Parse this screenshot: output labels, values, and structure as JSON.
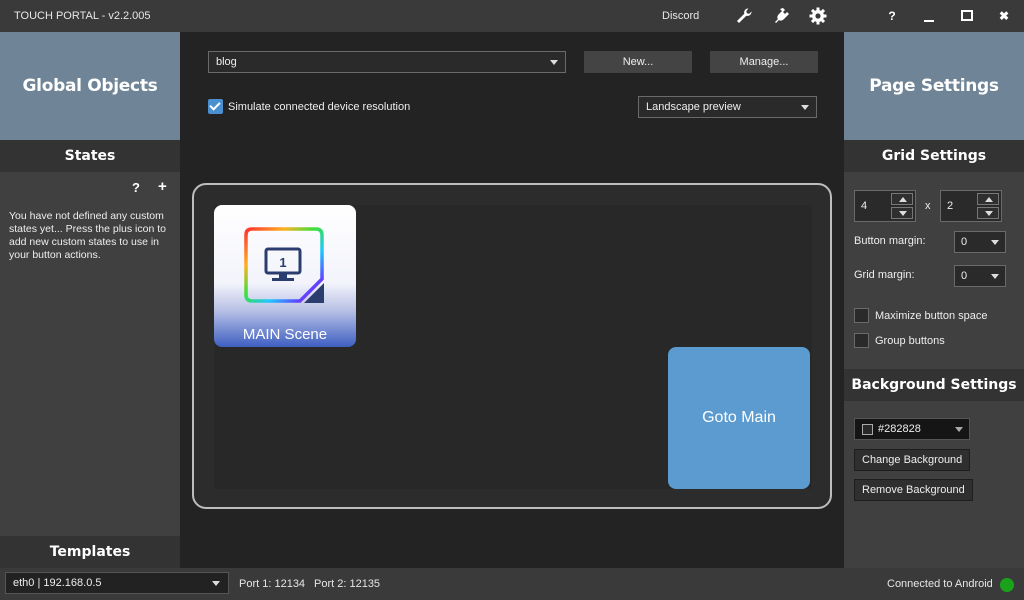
{
  "titlebar": {
    "title": "TOUCH PORTAL - v2.2.005",
    "discord_label": "Discord",
    "help_label": "?",
    "close_label": "✖"
  },
  "left": {
    "global_objects_label": "Global Objects",
    "states_header": "States",
    "states_help": "?",
    "states_add": "+",
    "states_message": "You have not defined any custom states yet... Press the plus icon to add new custom states to use in your button actions.",
    "templates_header": "Templates"
  },
  "center": {
    "page_select_value": "blog",
    "new_button": "New...",
    "manage_button": "Manage...",
    "simulate_label": "Simulate connected device resolution",
    "simulate_checked": true,
    "preview_select_value": "Landscape preview",
    "buttons": [
      {
        "label": "MAIN Scene",
        "icon": "monitor-icon",
        "monitor_number": "1"
      },
      {
        "label": "Goto Main",
        "color": "#5b9bd0"
      }
    ]
  },
  "right": {
    "page_settings_label": "Page Settings",
    "grid_settings_header": "Grid Settings",
    "grid_columns": "4",
    "grid_x_label": "x",
    "grid_rows": "2",
    "button_margin_label": "Button margin:",
    "button_margin_value": "0",
    "grid_margin_label": "Grid margin:",
    "grid_margin_value": "0",
    "maximize_label": "Maximize button space",
    "group_label": "Group buttons",
    "background_settings_header": "Background Settings",
    "background_color": "#282828",
    "change_background": "Change Background",
    "remove_background": "Remove Background"
  },
  "statusbar": {
    "network_value": "eth0 | 192.168.0.5",
    "port1": "Port 1: 12134",
    "port2": "Port 2: 12135",
    "connection": "Connected to Android",
    "connection_color": "#1aa31a"
  },
  "colors": {
    "accent": "#4a8fd0",
    "panel_header": "#6f8496"
  }
}
